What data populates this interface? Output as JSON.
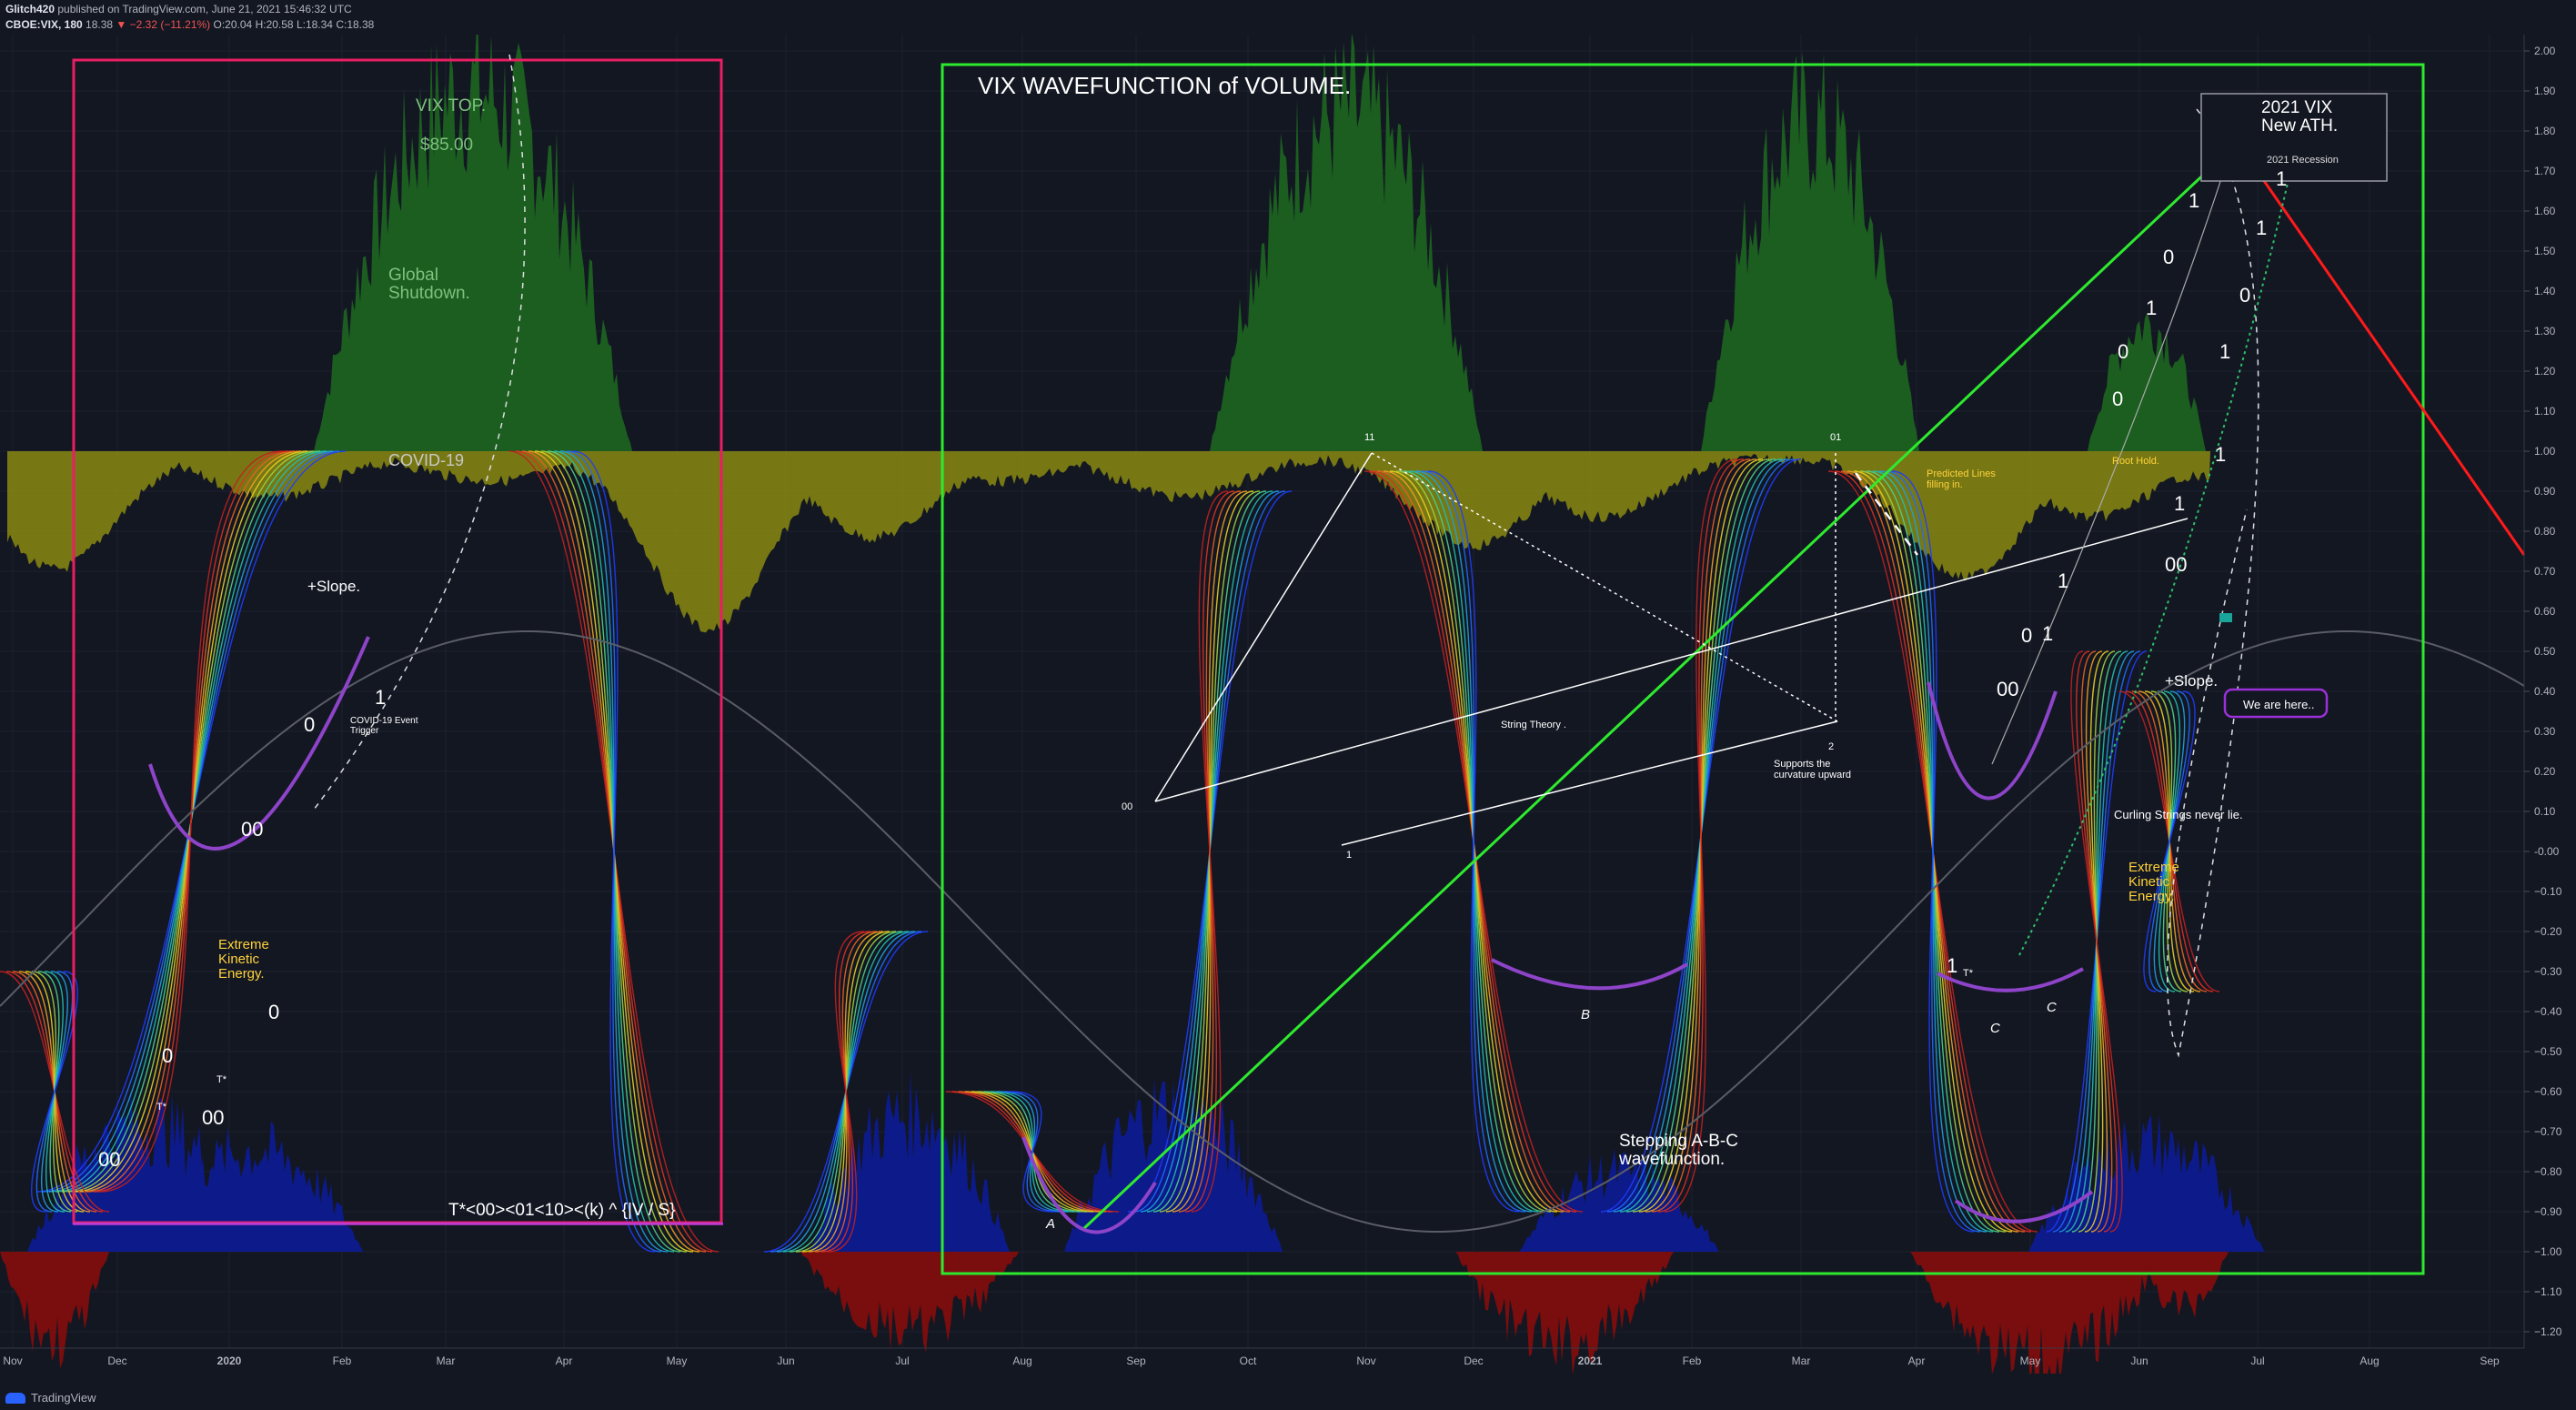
{
  "header": {
    "publisher": "Glitch420",
    "published_text": "published on TradingView.com, June 21, 2021 15:46:32 UTC",
    "symbol": "CBOE:VIX, 180",
    "last": "18.38",
    "change": "−2.32 (−11.21%)",
    "open": "O:20.04",
    "high": "H:20.58",
    "low": "L:18.34",
    "close": "C:18.38"
  },
  "footer": {
    "brand": "TradingView"
  },
  "colors": {
    "background": "#131722",
    "grid": "#1e2230",
    "green_area": "#1b5e20",
    "olive_area": "#8a8a12",
    "navy_area": "#0d1a8a",
    "dark_red_area": "#7a0d0d",
    "pink_box": "#e91e63",
    "green_box": "#2eea2e",
    "red_line": "#ff1a1a",
    "purple": "#8e44c9"
  },
  "chart_data": {
    "type": "line",
    "title": "VIX WAVEFUNCTION of VOLUME.",
    "ylim": [
      -1.25,
      2.02
    ],
    "y_ticks": [
      "2.00",
      "1.90",
      "1.80",
      "1.70",
      "1.60",
      "1.50",
      "1.40",
      "1.30",
      "1.20",
      "1.10",
      "1.00",
      "0.90",
      "0.80",
      "0.70",
      "0.60",
      "0.50",
      "0.40",
      "0.30",
      "0.20",
      "0.10",
      "-0.00",
      "−0.10",
      "−0.20",
      "−0.30",
      "−0.40",
      "−0.50",
      "−0.60",
      "−0.70",
      "−0.80",
      "−0.90",
      "−1.00",
      "−1.10",
      "−1.20"
    ],
    "x_ticks": [
      "Nov",
      "Dec",
      "2020",
      "Feb",
      "Mar",
      "Apr",
      "May",
      "Jun",
      "Jul",
      "Aug",
      "Sep",
      "Oct",
      "Nov",
      "Dec",
      "2021",
      "Feb",
      "Mar",
      "Apr",
      "May",
      "Jun",
      "Jul",
      "Aug",
      "Sep"
    ],
    "grid": true,
    "annotations": {
      "vix_top": "VIX TOP.",
      "vix_top_price": "$85.00",
      "global_shutdown": "Global\nShutdown.",
      "covid": "COVID-19",
      "covid_event": "COVID-19 Event\nTrigger",
      "slope1": "+Slope.",
      "slope2": "+Slope.",
      "extreme_ke_1": "Extreme\nKinetic\nEnergy.",
      "extreme_ke_2": "Extreme\nKinetic\nEnergy.",
      "formula": "T*<00><01<10><(k) ^ {|V / S}",
      "ath": "2021 VIX\nNew ATH.",
      "recession": "2021 Recession",
      "predicted": "Predicted  Lines\nfilling in.",
      "root_hold": "Root Hold.",
      "string_theory": "String Theory .",
      "supports": "Supports the\ncurvature upward",
      "we_are_here": "We are here..",
      "curling": "Curling Strings never lie.",
      "stepping": "Stepping A-B-C\nwavefunction.",
      "label_11": "11",
      "label_01": "01",
      "label_00_st": "00",
      "label_1_st": "1",
      "label_2_st": "2",
      "label_A": "A",
      "label_B": "B",
      "label_C1": "C",
      "label_C2": "C",
      "tstar_1": "T*",
      "tstar_2": "T*",
      "tstar_3": "T*",
      "left_digits": [
        "1",
        "0",
        "00",
        "0",
        "0",
        "00",
        "00"
      ],
      "right_digits": [
        "1",
        "1",
        "0",
        "1",
        "0",
        "1",
        "1",
        "0",
        "0",
        "1",
        "00",
        "1",
        "1",
        "1",
        "0",
        "00",
        "1"
      ]
    }
  }
}
